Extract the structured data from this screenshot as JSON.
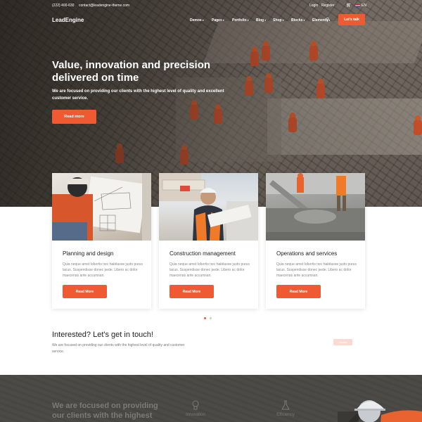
{
  "topbar": {
    "phone": "(222) 400-630",
    "email": "contact@leadengine-theme.com",
    "login": "Login",
    "register": "Register",
    "lang": "EN"
  },
  "nav": {
    "logo": "LeadEngine",
    "items": [
      "Demos",
      "Pages",
      "Portfolio",
      "Blog",
      "Shop",
      "Blocks",
      "Elements"
    ],
    "cta": "Let's talk"
  },
  "hero": {
    "title": "Value, innovation and precision delivered on time",
    "subtitle": "We are focused on providing our clients with the highest level of quality and excellent customer service.",
    "button": "Read more"
  },
  "cards": [
    {
      "title": "Planning and design",
      "text": "Quia neque amet lobortis nec habitasse justo purus lacus. Suspendisse donec pede. Libero ac dolor maecenas ante accumsan.",
      "button": "Read More"
    },
    {
      "title": "Construction management",
      "text": "Quia neque amet lobortis nec habitasse justo purus lacus. Suspendisse donec pede. Libero ac dolor maecenas ante accumsan.",
      "button": "Read More"
    },
    {
      "title": "Operations and services",
      "text": "Quia neque amet lobortis nec habitasse justo purus lacus. Suspendisse donec pede. Libero ac dolor maecenas ante accumsan.",
      "button": "Read More"
    }
  ],
  "contact": {
    "title": "Interested? Let's get in touch!",
    "text": "We are focused on providing our clients with the highest level of quality and customer service.",
    "button": "Contact"
  },
  "bottom": {
    "title": "We are focused on providing our clients with the highest",
    "features": [
      "Innovation",
      "Efficiency"
    ]
  },
  "colors": {
    "accent": "#ef5a33",
    "dark_band": "#4b4a46"
  }
}
